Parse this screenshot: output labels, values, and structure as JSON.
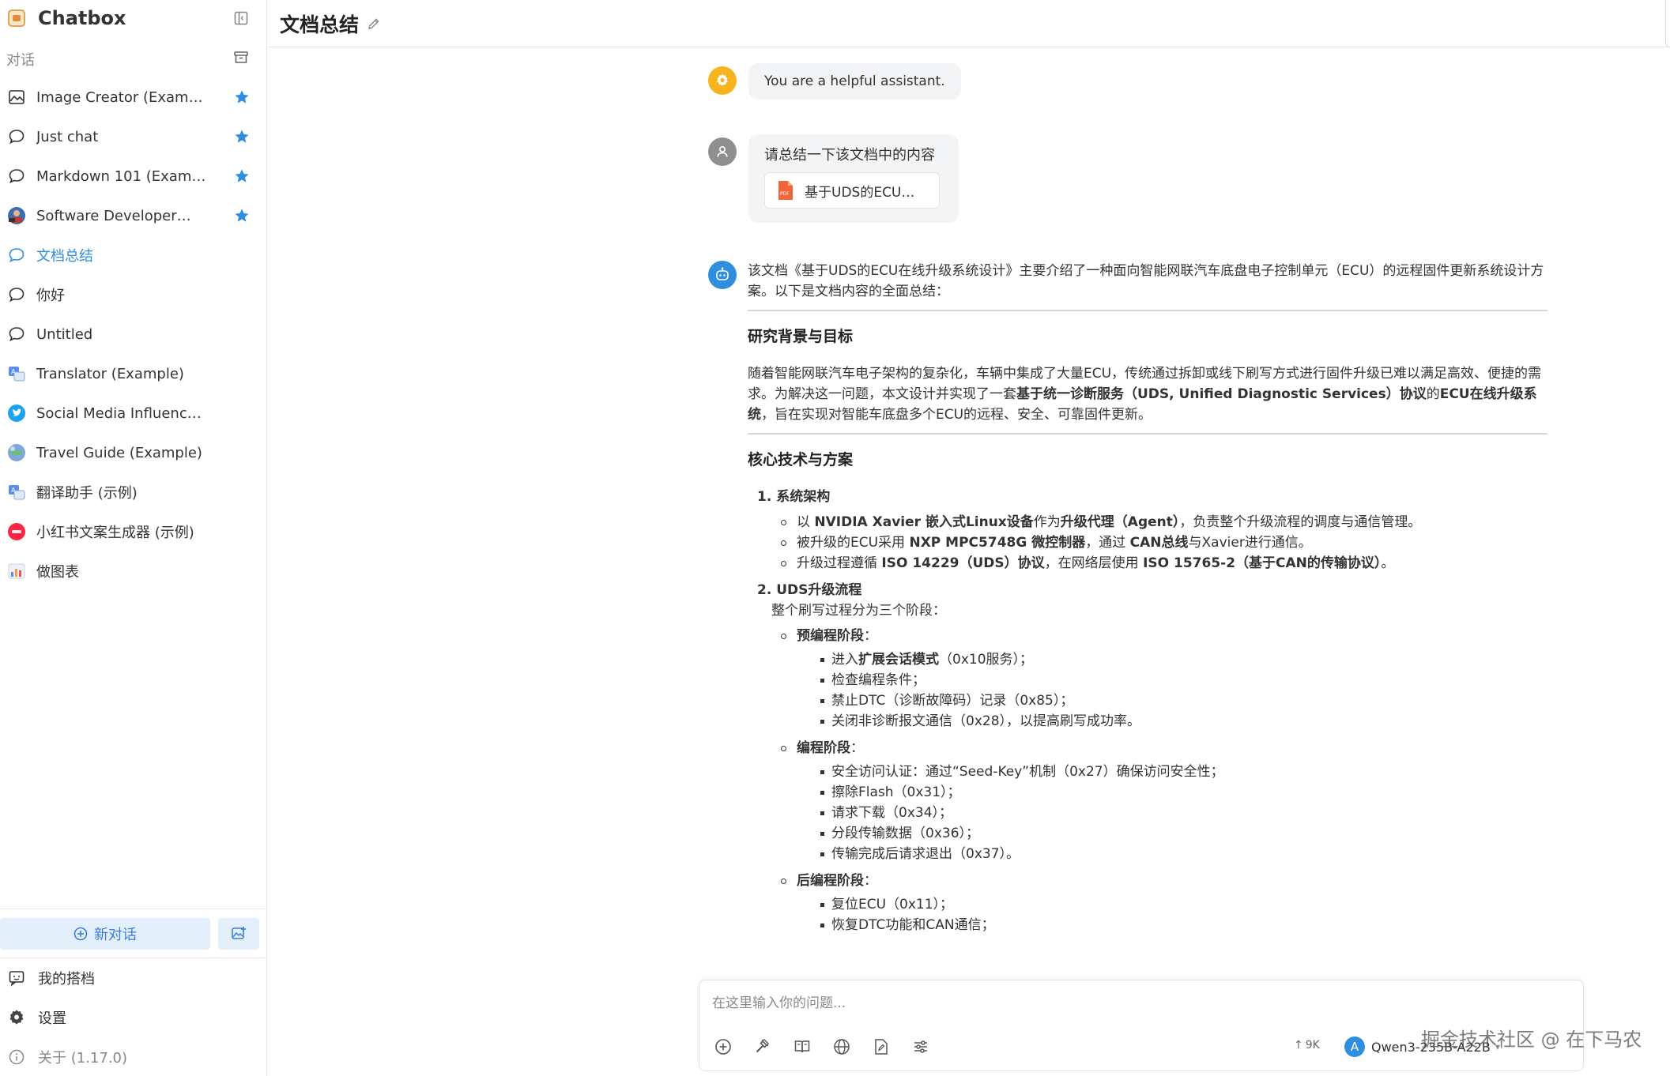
{
  "app": {
    "title": "Chatbox",
    "section_label": "对话"
  },
  "sidebar": {
    "items": [
      {
        "label": "Image Creator (Example)",
        "icon": "image-icon",
        "starred": true
      },
      {
        "label": "Just chat",
        "icon": "chat-bubble-icon",
        "starred": true
      },
      {
        "label": "Markdown 101 (Example)",
        "icon": "chat-bubble-icon",
        "starred": true
      },
      {
        "label": "Software Developer…",
        "icon": "developer-avatar",
        "starred": true
      },
      {
        "label": "文档总结",
        "icon": "chat-bubble-icon",
        "starred": false,
        "active": true
      },
      {
        "label": "你好",
        "icon": "chat-bubble-icon",
        "starred": false
      },
      {
        "label": "Untitled",
        "icon": "chat-bubble-icon",
        "starred": false
      },
      {
        "label": "Translator (Example)",
        "icon": "translator-avatar",
        "starred": false
      },
      {
        "label": "Social Media Influencer…",
        "icon": "twitter-avatar",
        "starred": false
      },
      {
        "label": "Travel Guide (Example)",
        "icon": "globe-avatar",
        "starred": false
      },
      {
        "label": "翻译助手 (示例)",
        "icon": "translator-avatar",
        "starred": false
      },
      {
        "label": "小红书文案生成器 (示例)",
        "icon": "xiaohongshu-avatar",
        "starred": false
      },
      {
        "label": "做图表",
        "icon": "chart-avatar",
        "starred": false
      }
    ],
    "new_chat_label": "新对话",
    "bottom": {
      "my_partners": "我的搭档",
      "settings": "设置",
      "about": "关于 (1.17.0)"
    }
  },
  "header": {
    "title": "文档总结"
  },
  "messages": {
    "system": "You are a helpful assistant.",
    "user_text": "请总结一下该文档中的内容",
    "attachment_name": "基于UDS的ECU…",
    "attachment_badge": "PDF",
    "assistant": {
      "intro": "该文档《基于UDS的ECU在线升级系统设计》主要介绍了一种面向智能网联汽车底盘电子控制单元（ECU）的远程固件更新系统设计方案。以下是文档内容的全面总结：",
      "h1": "研究背景与目标",
      "p1_a": "随着智能网联汽车电子架构的复杂化，车辆中集成了大量ECU，传统通过拆卸或线下刷写方式进行固件升级已难以满足高效、便捷的需求。为解决这一问题，本文设计并实现了一套",
      "p1_b": "基于统一诊断服务（UDS, Unified Diagnostic Services）协议",
      "p1_c": "的",
      "p1_d": "ECU在线升级系统",
      "p1_e": "，旨在实现对智能车底盘多个ECU的远程、安全、可靠固件更新。",
      "h2": "核心技术与方案",
      "s1_title": "1. 系统架构",
      "s1_b1_a": "以 ",
      "s1_b1_b": "NVIDIA Xavier 嵌入式Linux设备",
      "s1_b1_c": "作为",
      "s1_b1_d": "升级代理（Agent）",
      "s1_b1_e": "，负责整个升级流程的调度与通信管理。",
      "s1_b2_a": "被升级的ECU采用 ",
      "s1_b2_b": "NXP MPC5748G 微控制器",
      "s1_b2_c": "，通过 ",
      "s1_b2_d": "CAN总线",
      "s1_b2_e": "与Xavier进行通信。",
      "s1_b3_a": "升级过程遵循 ",
      "s1_b3_b": "ISO 14229（UDS）协议",
      "s1_b3_c": "，在网络层使用 ",
      "s1_b3_d": "ISO 15765-2（基于CAN的传输协议）",
      "s1_b3_e": "。",
      "s2_title": "2. UDS升级流程",
      "s2_sub": "整个刷写过程分为三个阶段：",
      "stage1": "预编程阶段",
      "stage1_items": [
        "检查编程条件；",
        "禁止DTC（诊断故障码）记录（0x85）；",
        "关闭非诊断报文通信（0x28），以提高刷写成功率。"
      ],
      "stage1_first_a": "进入",
      "stage1_first_b": "扩展会话模式",
      "stage1_first_c": "（0x10服务）；",
      "stage2": "编程阶段",
      "stage2_items": [
        "安全访问认证：通过“Seed-Key”机制（0x27）确保访问安全性；",
        "擦除Flash（0x31）；",
        "请求下载（0x34）；",
        "分段传输数据（0x36）；",
        "传输完成后请求退出（0x37）。"
      ],
      "stage3": "后编程阶段",
      "stage3_items": [
        "复位ECU（0x11）；",
        "恢复DTC功能和CAN通信；"
      ],
      "colon": "："
    }
  },
  "input": {
    "placeholder": "在这里输入你的问题...",
    "token_count": "9K",
    "model_name": "Qwen3-235B-A22B",
    "model_badge": "A"
  },
  "watermark": "掘金技术社区 @ 在下马农",
  "colors": {
    "accent": "#2f8ee0",
    "new_chat_bg": "#e3effb",
    "system_avatar": "#f6b51e",
    "star": "#2f8ee0"
  }
}
